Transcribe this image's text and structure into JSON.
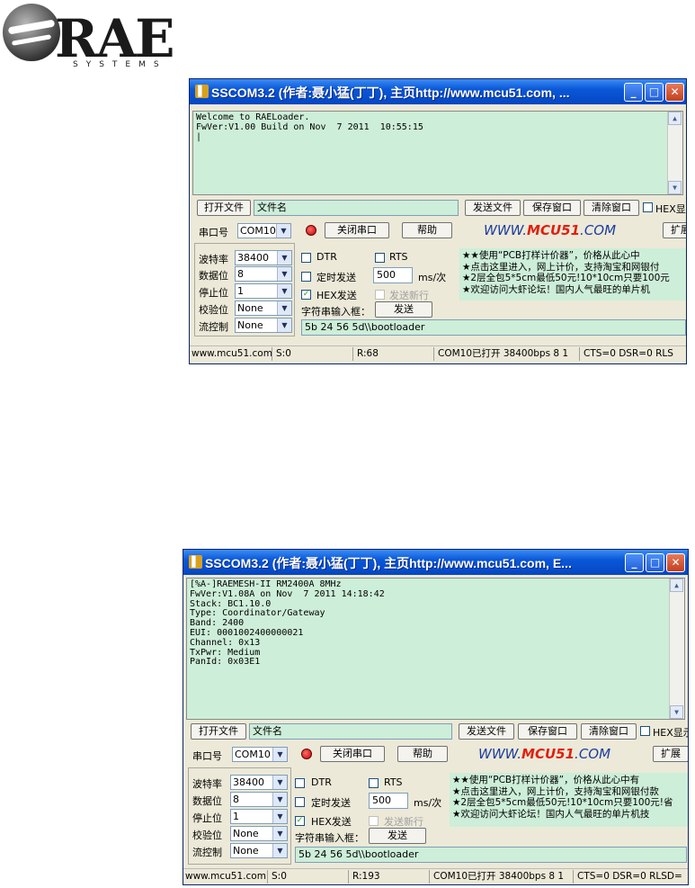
{
  "logo": {
    "main": "RAE",
    "sub": "SYSTEMS"
  },
  "windows": [
    {
      "title": "SSCOM3.2 (作者:聂小猛(丁丁), 主页http://www.mcu51.com, ...",
      "receive_lines": [
        "Welcome to RAELoader.",
        "FwVer:V1.00 Build on Nov  7 2011  10:55:15",
        "|"
      ],
      "open_file_label": "打开文件",
      "file_name_value": "文件名",
      "send_file_label": "发送文件",
      "save_window_label": "保存窗口",
      "clear_window_label": "清除窗口",
      "hex_display_label": "HEX显",
      "port_label": "串口号",
      "port_value": "COM10",
      "close_port_label": "关闭串口",
      "help_label": "帮助",
      "brand_pre": "WWW.",
      "brand_mid": "MCU51",
      "brand_post": ".COM",
      "expand_label": "扩展",
      "baud_label": "波特率",
      "baud_value": "38400",
      "databits_label": "数据位",
      "databits_value": "8",
      "stopbits_label": "停止位",
      "stopbits_value": "1",
      "parity_label": "校验位",
      "parity_value": "None",
      "flow_label": "流控制",
      "flow_value": "None",
      "dtr_label": "DTR",
      "rts_label": "RTS",
      "timed_send_label": "定时发送",
      "interval_value": "500",
      "interval_unit": "ms/次",
      "hex_send_label": "HEX发送",
      "send_newline_label": "发送新行",
      "input_label": "字符串输入框：",
      "send_label": "发送",
      "input_value": "5b 24 56 5d\\\\bootloader",
      "ads": [
        "★★使用“PCB打样计价器”，价格从此心中",
        "★点击这里进入，网上计价，支持淘宝和网银付",
        "★2层全包5*5cm最低50元!10*10cm只要100元",
        "★欢迎访问大虾论坛！国内人气最旺的单片机"
      ],
      "status": {
        "site": "www.mcu51.com",
        "s": "S:0",
        "r": "R:68",
        "port_state": "COM10已打开  38400bps  8 1",
        "lines": "CTS=0 DSR=0 RLS"
      }
    },
    {
      "title": "SSCOM3.2 (作者:聂小猛(丁丁), 主页http://www.mcu51.com,  E...",
      "receive_lines": [
        "[%A-]RAEMESH-II RM2400A 8MHz",
        "FwVer:V1.08A on Nov  7 2011 14:18:42",
        "Stack: BC1.10.0",
        "Type: Coordinator/Gateway",
        "Band: 2400",
        "EUI: 0001002400000021",
        "Channel: 0x13",
        "TxPwr: Medium",
        "PanId: 0x03E1"
      ],
      "open_file_label": "打开文件",
      "file_name_value": "文件名",
      "send_file_label": "发送文件",
      "save_window_label": "保存窗口",
      "clear_window_label": "清除窗口",
      "hex_display_label": "HEX显示",
      "port_label": "串口号",
      "port_value": "COM10",
      "close_port_label": "关闭串口",
      "help_label": "帮助",
      "brand_pre": "WWW.",
      "brand_mid": "MCU51",
      "brand_post": ".COM",
      "expand_label": "扩展",
      "baud_label": "波特率",
      "baud_value": "38400",
      "databits_label": "数据位",
      "databits_value": "8",
      "stopbits_label": "停止位",
      "stopbits_value": "1",
      "parity_label": "校验位",
      "parity_value": "None",
      "flow_label": "流控制",
      "flow_value": "None",
      "dtr_label": "DTR",
      "rts_label": "RTS",
      "timed_send_label": "定时发送",
      "interval_value": "500",
      "interval_unit": "ms/次",
      "hex_send_label": "HEX发送",
      "send_newline_label": "发送新行",
      "input_label": "字符串输入框：",
      "send_label": "发送",
      "input_value": "5b 24 56 5d\\\\bootloader",
      "ads": [
        "★★使用“PCB打样计价器”，价格从此心中有",
        "★点击这里进入，网上计价，支持淘宝和网银付款",
        "★2层全包5*5cm最低50元!10*10cm只要100元!省",
        "★欢迎访问大虾论坛！国内人气最旺的单片机技"
      ],
      "status": {
        "site": "www.mcu51.com",
        "s": "S:0",
        "r": "R:193",
        "port_state": "COM10已打开  38400bps  8 1",
        "lines": "CTS=0 DSR=0 RLSD="
      }
    }
  ]
}
